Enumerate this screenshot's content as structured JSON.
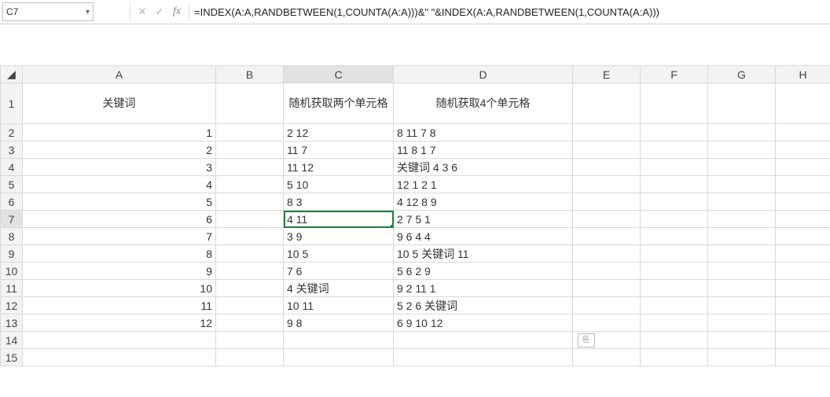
{
  "name_box": "C7",
  "formula": "=INDEX(A:A,RANDBETWEEN(1,COUNTA(A:A)))&\" \"&INDEX(A:A,RANDBETWEEN(1,COUNTA(A:A)))",
  "fx_label": "fx",
  "columns": [
    "A",
    "B",
    "C",
    "D",
    "E",
    "F",
    "G",
    "H"
  ],
  "visible_row_numbers": [
    1,
    2,
    3,
    4,
    5,
    6,
    7,
    8,
    9,
    10,
    11,
    12,
    13,
    14,
    15
  ],
  "selected_cell": "C7",
  "smart_tag_glyph": "⎘",
  "headers": {
    "A": "关键词",
    "C": "随机获取两个单元格",
    "D": "随机获取4个单元格"
  },
  "colA": [
    "1",
    "2",
    "3",
    "4",
    "5",
    "6",
    "7",
    "8",
    "9",
    "10",
    "11",
    "12"
  ],
  "colC": [
    "2 12",
    "11 7",
    "11 12",
    "5 10",
    "8 3",
    "4 11",
    "3 9",
    "10 5",
    "7 6",
    "4 关键词",
    "10 11",
    "9 8"
  ],
  "colD": [
    "8 11 7 8",
    "11 8 1 7",
    "关键词 4 3 6",
    "12 1 2 1",
    "4 12 8 9",
    "2 7 5 1",
    "9 6 4 4",
    "10 5 关键词 11",
    "5 6 2 9",
    "9 2 11 1",
    "5 2 6 关键词",
    "6 9 10 12"
  ]
}
